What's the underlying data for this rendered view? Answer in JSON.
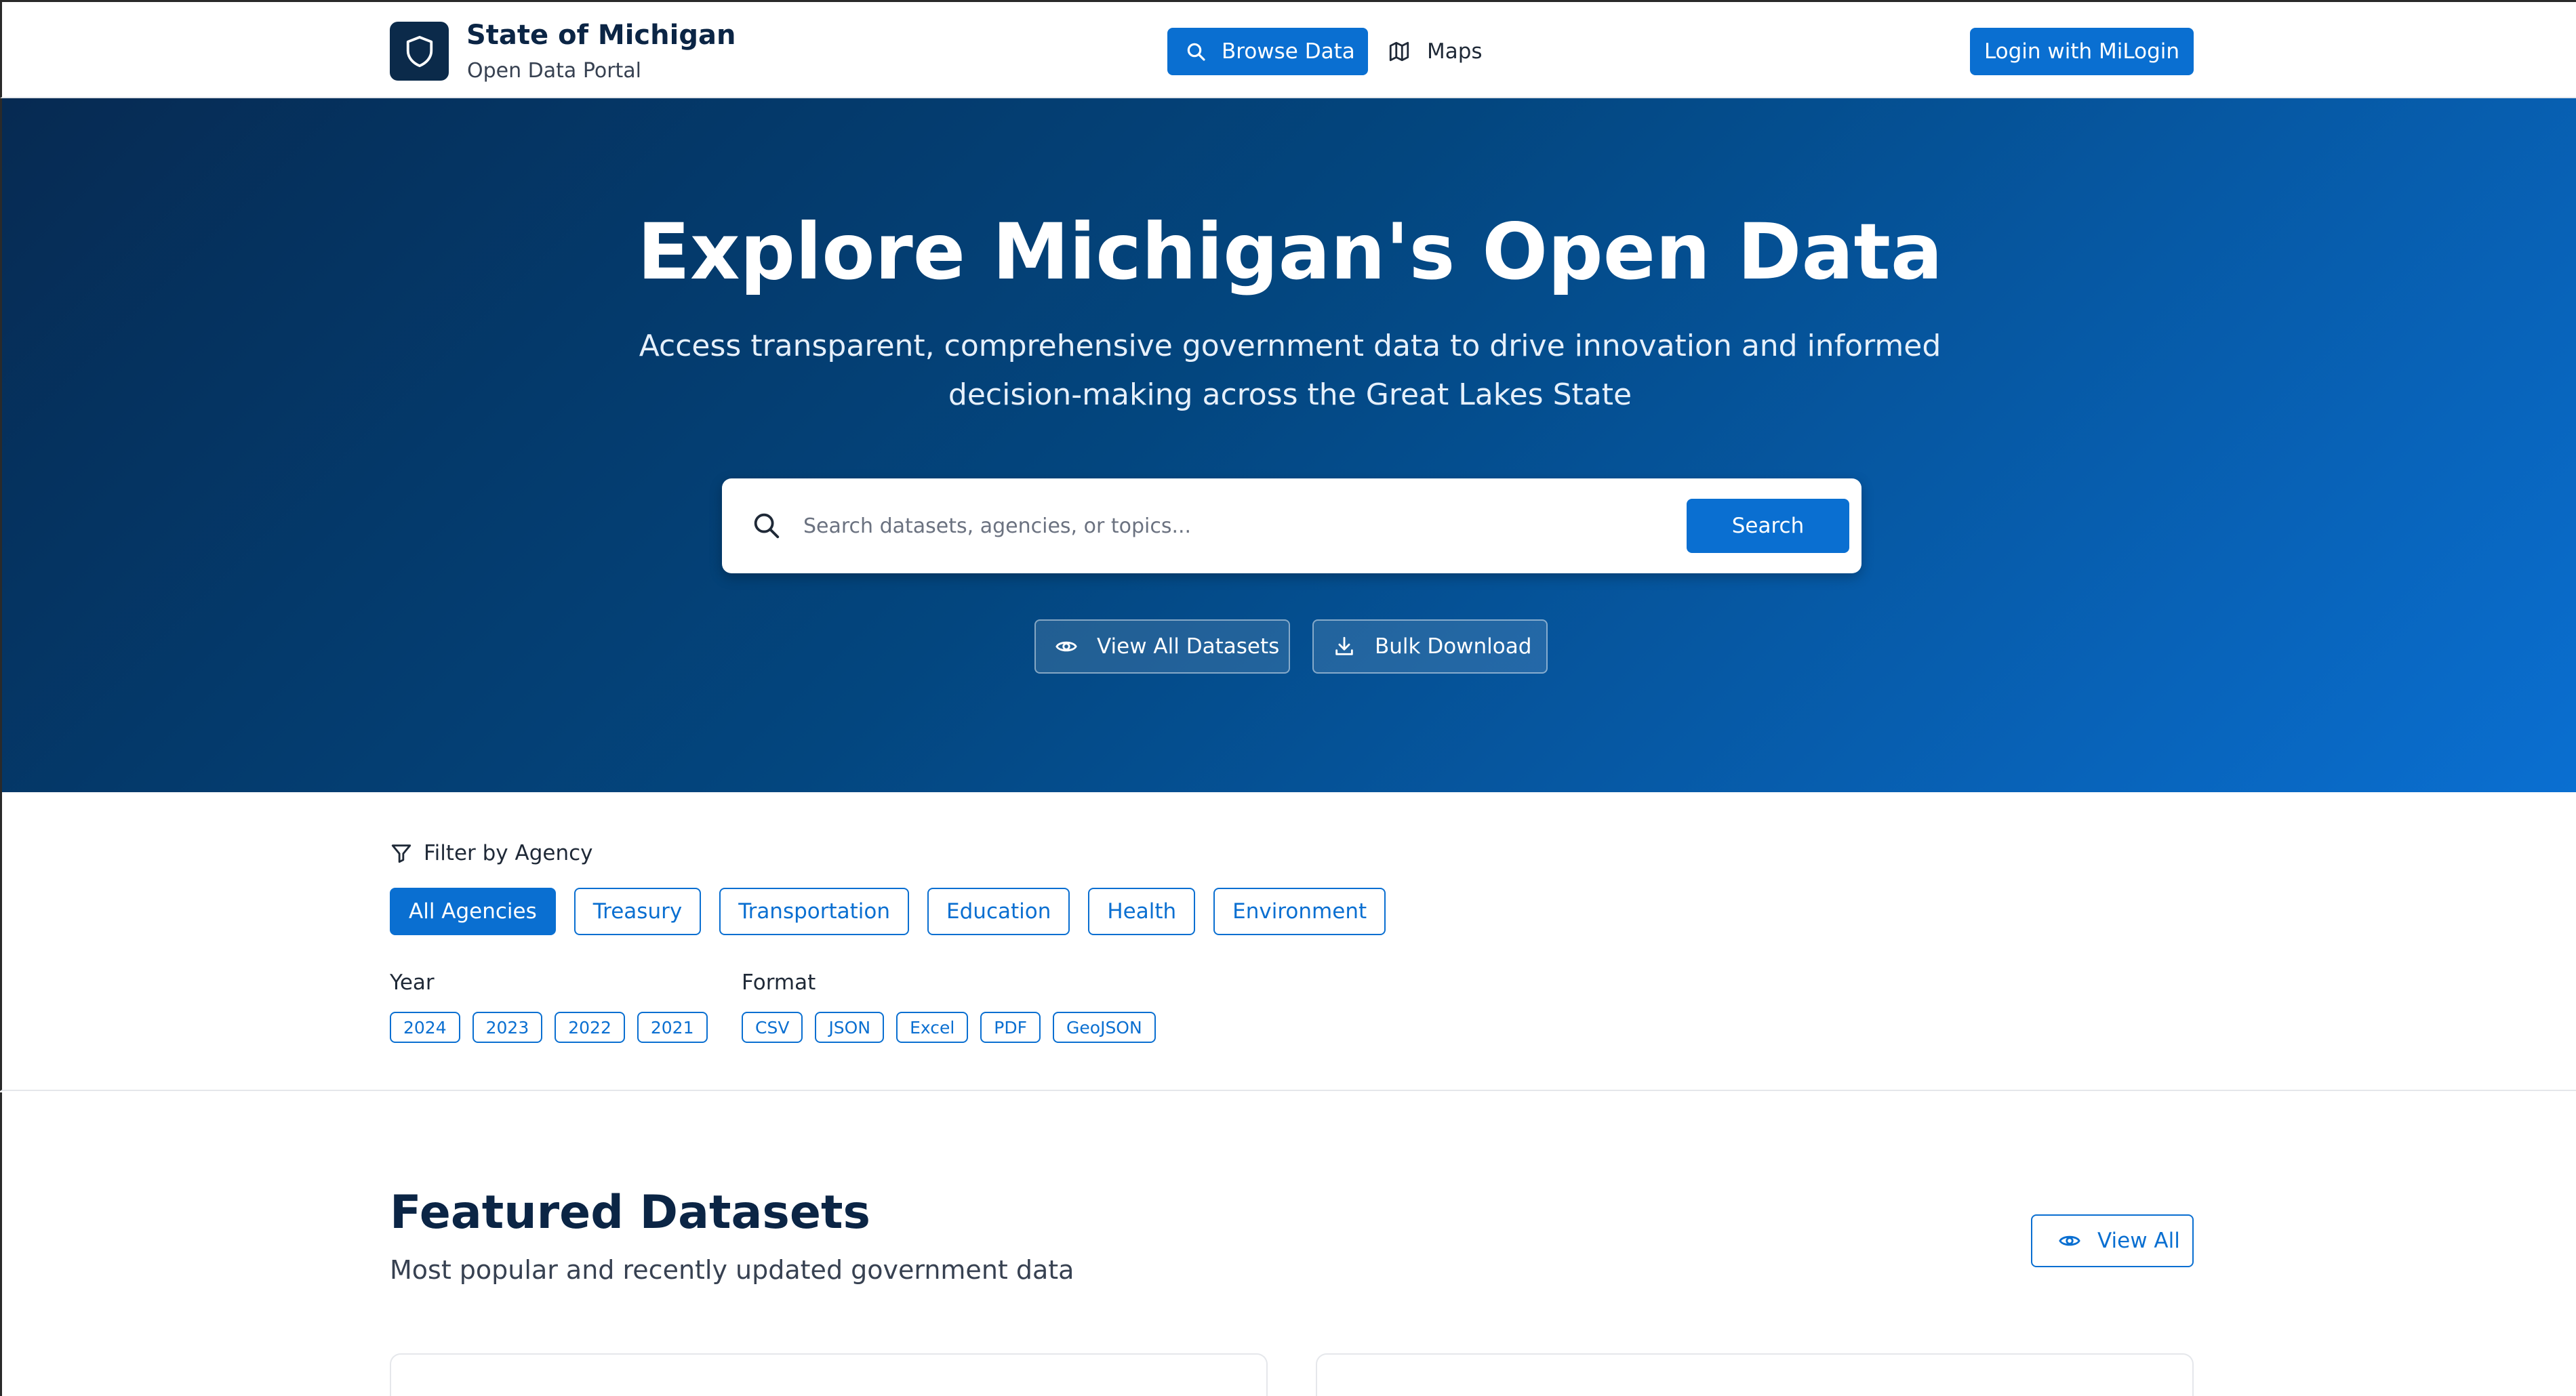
{
  "header": {
    "brand_title": "State of Michigan",
    "brand_subtitle": "Open Data Portal",
    "nav": [
      {
        "label": "Browse Data",
        "icon": "search-icon",
        "active": true
      },
      {
        "label": "Maps",
        "icon": "map-icon",
        "active": false
      }
    ],
    "login_label": "Login with MiLogin"
  },
  "hero": {
    "title": "Explore Michigan's Open Data",
    "subtitle": "Access transparent, comprehensive government data to drive innovation and informed decision-making across the Great Lakes State",
    "search_placeholder": "Search datasets, agencies, or topics...",
    "search_button": "Search",
    "view_all_datasets": "View All Datasets",
    "bulk_download": "Bulk Download"
  },
  "filters": {
    "agency_label": "Filter by Agency",
    "agencies": [
      "All Agencies",
      "Treasury",
      "Transportation",
      "Education",
      "Health",
      "Environment"
    ],
    "active_agency": "All Agencies",
    "year_label": "Year",
    "years": [
      "2024",
      "2023",
      "2022",
      "2021"
    ],
    "format_label": "Format",
    "formats": [
      "CSV",
      "JSON",
      "Excel",
      "PDF",
      "GeoJSON"
    ]
  },
  "featured": {
    "title": "Featured Datasets",
    "subtitle": "Most popular and recently updated government data",
    "view_all_label": "View All"
  },
  "colors": {
    "primary": "#0a6fd1",
    "navy": "#0b2545",
    "hero_dark": "#062a52",
    "hero_light": "#0a6fd1"
  }
}
